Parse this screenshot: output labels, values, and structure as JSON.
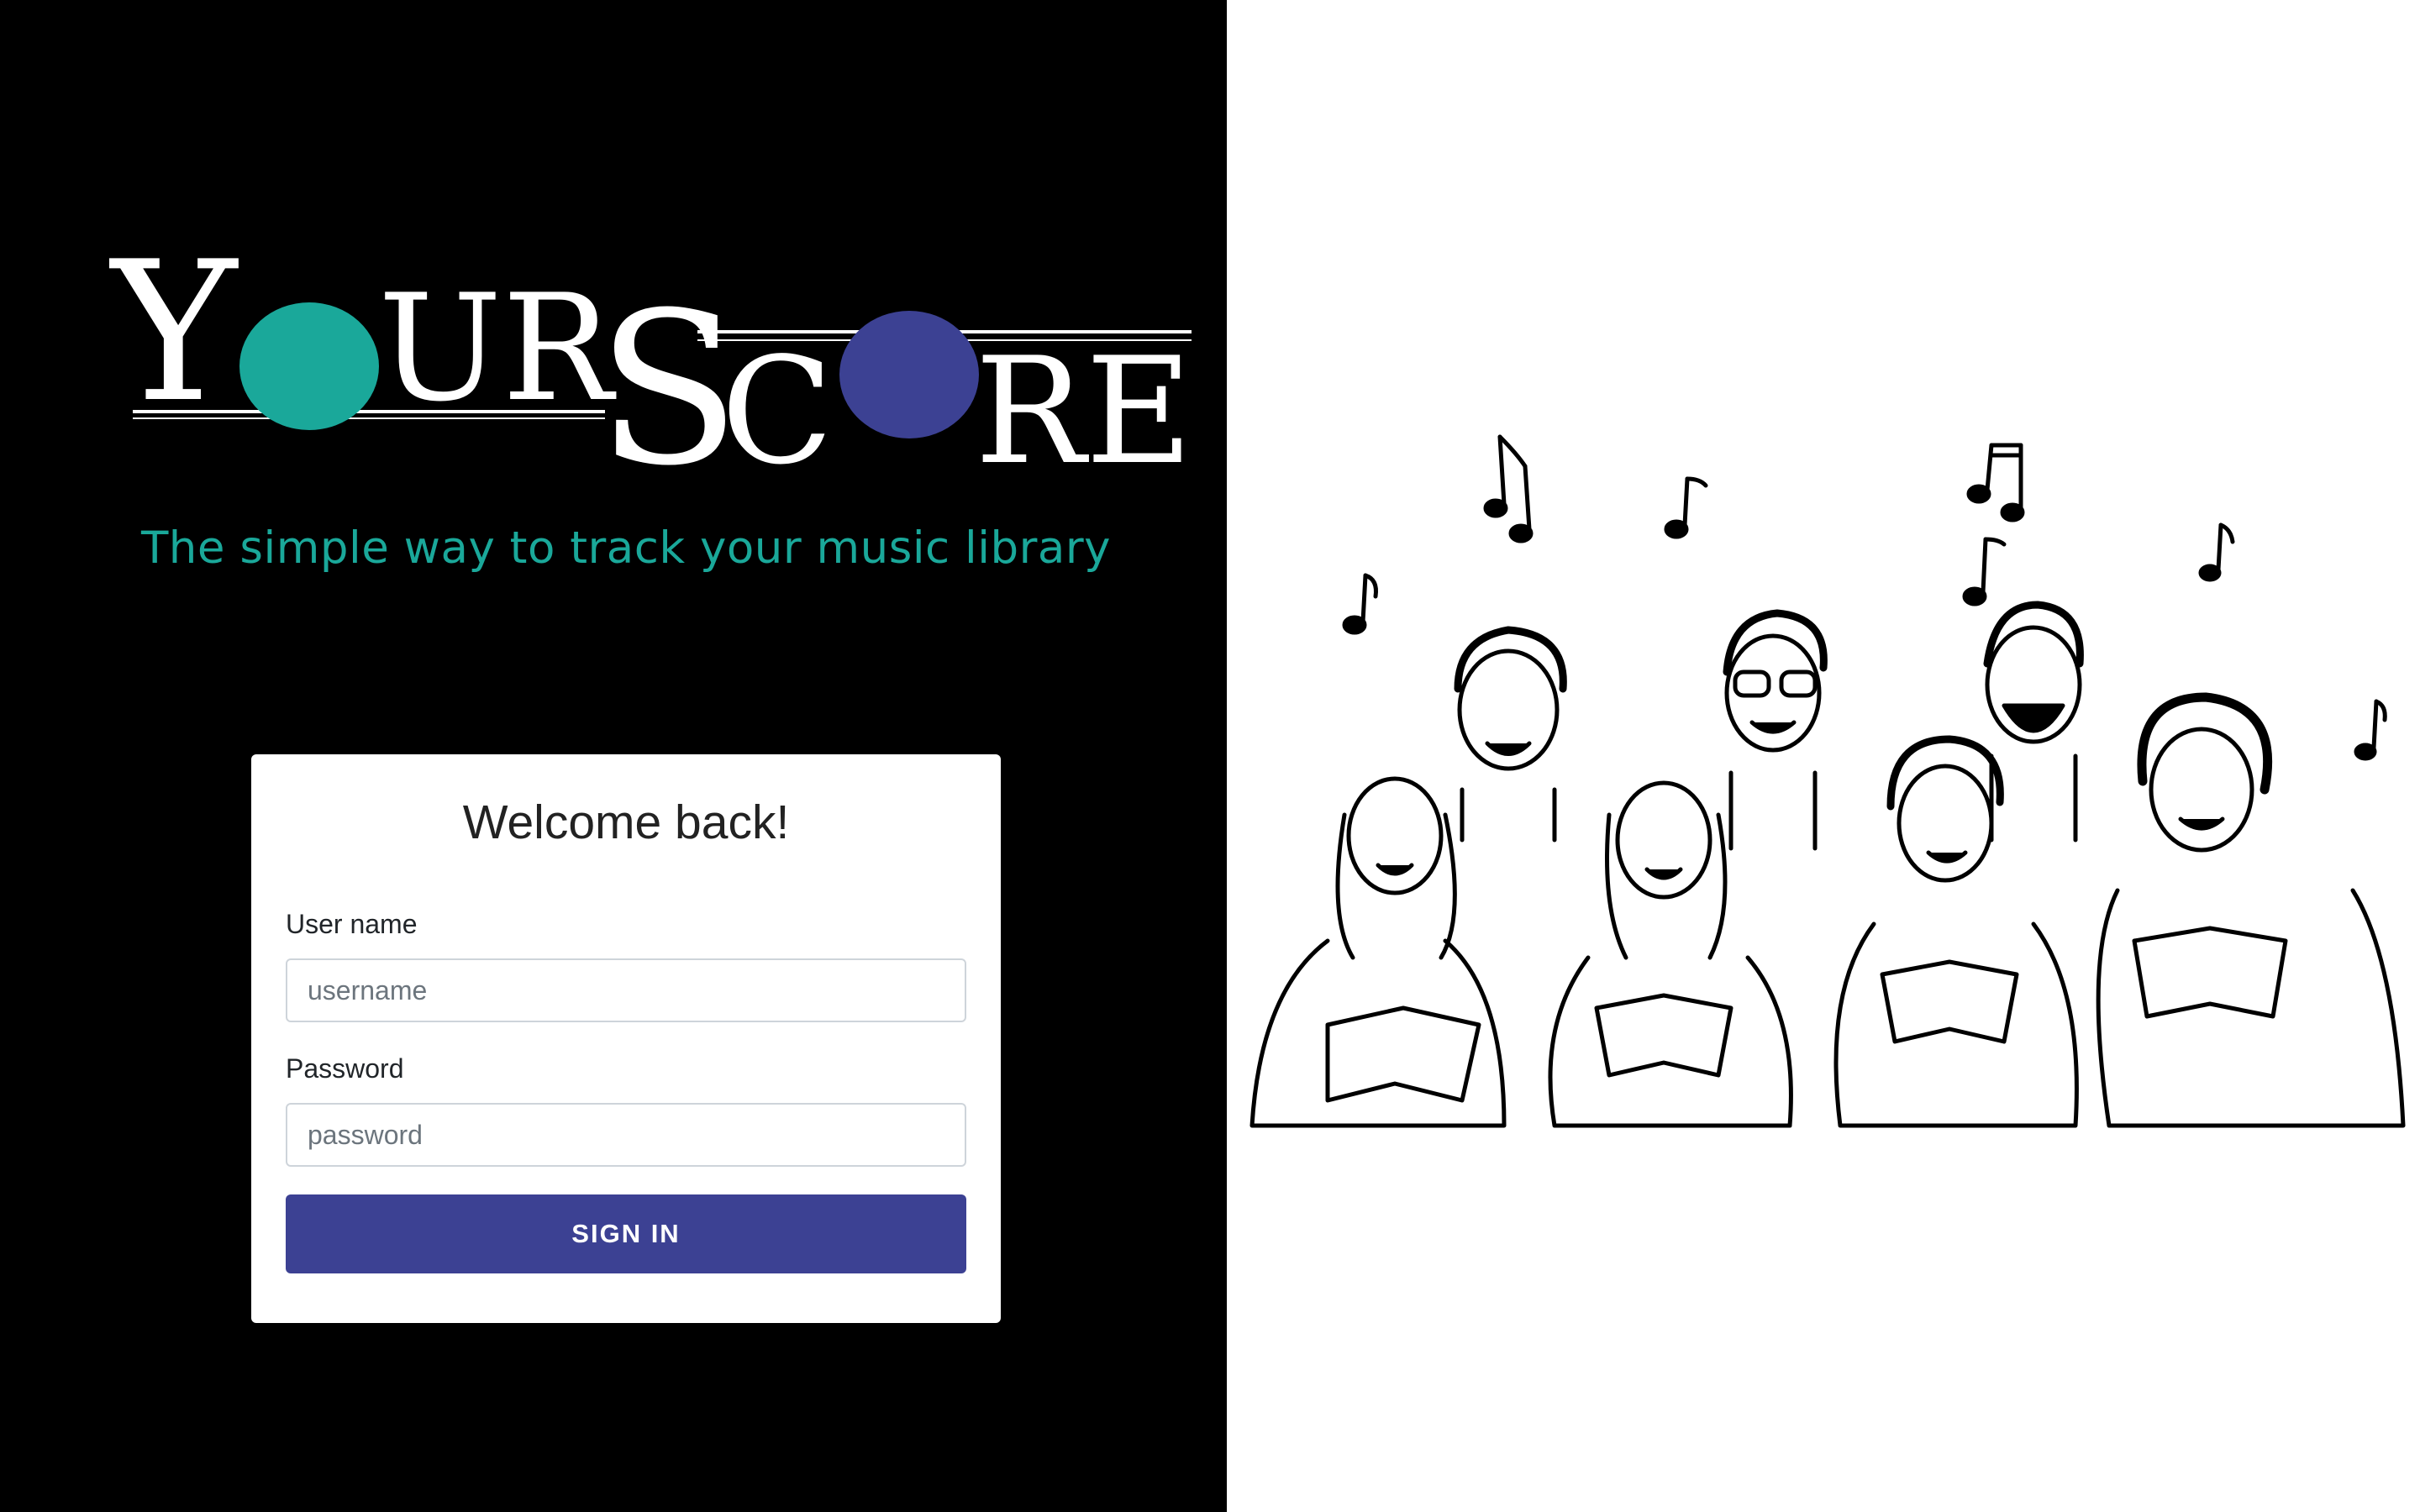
{
  "logo": {
    "text": "YOURSCORE",
    "colors": {
      "o1": "#1aa89a",
      "o2": "#3c4193",
      "text": "#ffffff"
    }
  },
  "tagline": "The simple way to track your music library",
  "login": {
    "title": "Welcome back!",
    "username_label": "User name",
    "username_placeholder": "username",
    "username_value": "",
    "password_label": "Password",
    "password_placeholder": "password",
    "password_value": "",
    "signin_label": "SIGN IN"
  },
  "colors": {
    "accent_teal": "#1aa89a",
    "accent_indigo": "#3c4193",
    "left_bg": "#000000",
    "right_bg": "#ffffff"
  },
  "illustration": {
    "subject": "choir-singers-sketch"
  }
}
